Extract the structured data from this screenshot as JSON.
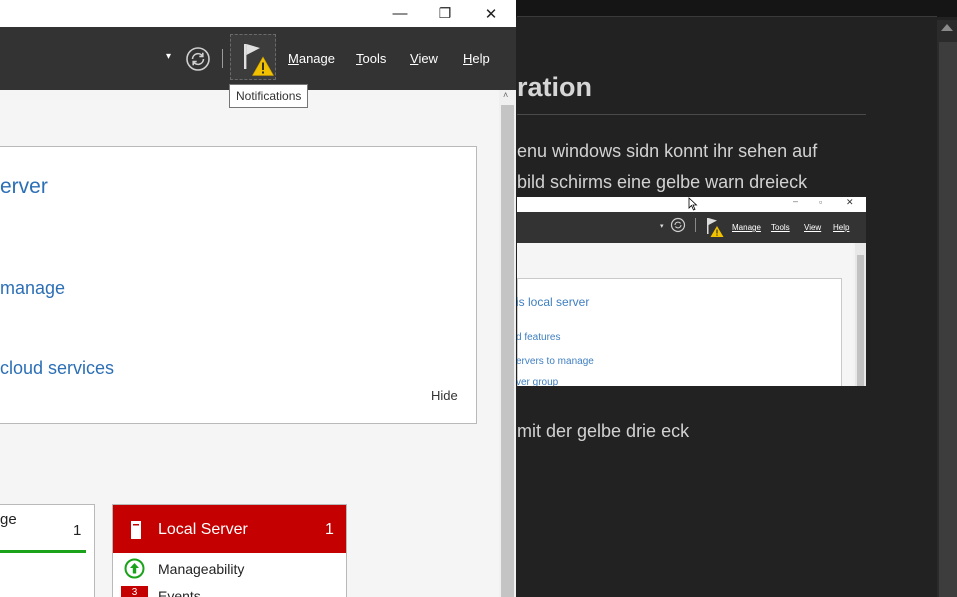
{
  "document": {
    "heading": "ration",
    "line1": "enu windows sidn konnt ihr sehen auf",
    "line2": "bild schirms eine gelbe warn dreieck",
    "line3": "mit der gelbe drie eck"
  },
  "embedded_screenshot": {
    "menus": [
      "Manage",
      "Tools",
      "View",
      "Help"
    ],
    "links": [
      "is local server",
      "d features",
      "ervers to manage",
      "ver group"
    ]
  },
  "window": {
    "controls": {
      "minimize": "—",
      "restore": "❐",
      "close": "✕"
    },
    "toolbar": {
      "menus": [
        {
          "accel": "M",
          "rest": "anage"
        },
        {
          "accel": "T",
          "rest": "ools"
        },
        {
          "accel": "V",
          "rest": "iew"
        },
        {
          "accel": "H",
          "rest": "elp"
        }
      ],
      "tooltip": "Notifications"
    },
    "welcome": {
      "link1": "erver",
      "link2": "manage",
      "link3": "cloud services",
      "hide": "Hide"
    },
    "tiles": {
      "tile1_title": "ge",
      "tile1_count": "1",
      "tile2_title": "Local Server",
      "tile2_count": "1",
      "tile2_row1": "Manageability",
      "tile2_row2_badge": "3",
      "tile2_row2": "Events"
    },
    "colors": {
      "toolbar": "#333333",
      "tile_red": "#c40000",
      "link_blue": "#2c6fb5",
      "ok_green": "#1aa31a",
      "warn_yellow": "#f2c200"
    }
  }
}
